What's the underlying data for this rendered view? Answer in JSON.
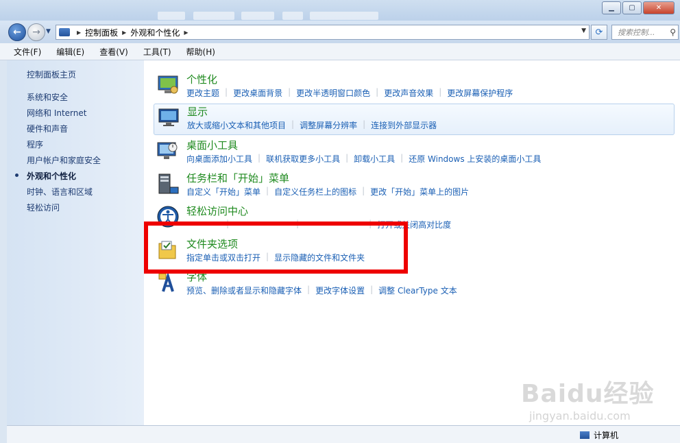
{
  "breadcrumb": {
    "items": [
      "控制面板",
      "外观和个性化"
    ]
  },
  "search": {
    "placeholder": "搜索控制..."
  },
  "menu": [
    "文件(F)",
    "编辑(E)",
    "查看(V)",
    "工具(T)",
    "帮助(H)"
  ],
  "sidebar": {
    "home": "控制面板主页",
    "items": [
      "系统和安全",
      "网络和 Internet",
      "硬件和声音",
      "程序",
      "用户帐户和家庭安全",
      "外观和个性化",
      "时钟、语言和区域",
      "轻松访问"
    ],
    "active_index": 5
  },
  "categories": [
    {
      "title": "个性化",
      "icon": "personalization-icon",
      "links": [
        "更改主题",
        "更改桌面背景",
        "更改半透明窗口颜色",
        "更改声音效果",
        "更改屏幕保护程序"
      ]
    },
    {
      "title": "显示",
      "icon": "display-icon",
      "links": [
        "放大或缩小文本和其他项目",
        "调整屏幕分辨率",
        "连接到外部显示器"
      ]
    },
    {
      "title": "桌面小工具",
      "icon": "gadgets-icon",
      "links": [
        "向桌面添加小工具",
        "联机获取更多小工具",
        "卸载小工具",
        "还原 Windows 上安装的桌面小工具"
      ]
    },
    {
      "title": "任务栏和「开始」菜单",
      "icon": "taskbar-icon",
      "links": [
        "自定义「开始」菜单",
        "自定义任务栏上的图标",
        "更改「开始」菜单上的图片"
      ]
    },
    {
      "title": "轻松访问中心",
      "icon": "ease-of-access-icon",
      "links": [
        "",
        "",
        "",
        "打开或关闭高对比度"
      ]
    },
    {
      "title": "文件夹选项",
      "icon": "folder-options-icon",
      "links": [
        "指定单击或双击打开",
        "显示隐藏的文件和文件夹"
      ]
    },
    {
      "title": "字体",
      "icon": "fonts-icon",
      "links": [
        "预览、删除或者显示和隐藏字体",
        "更改字体设置",
        "调整 ClearType 文本"
      ]
    }
  ],
  "status": {
    "computer": "计算机"
  },
  "watermark": {
    "brand": "Baidu经验",
    "url": "jingyan.baidu.com"
  },
  "colors": {
    "category_title": "#1f8a1f",
    "link": "#1a5fb4",
    "highlight_box": "#ee0000"
  }
}
